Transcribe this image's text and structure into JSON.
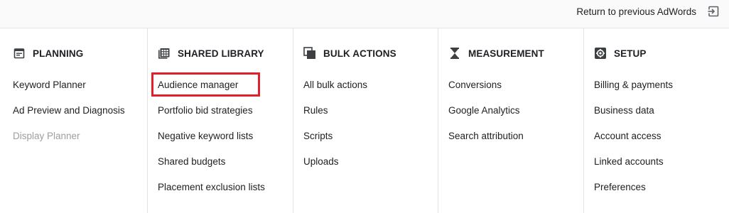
{
  "topbar": {
    "return_label": "Return to previous AdWords",
    "return_icon": "exit-to-app-icon"
  },
  "columns": [
    {
      "title": "PLANNING",
      "icon": "calendar-icon",
      "items": [
        {
          "label": "Keyword Planner",
          "disabled": false
        },
        {
          "label": "Ad Preview and Diagnosis",
          "disabled": false
        },
        {
          "label": "Display Planner",
          "disabled": true
        }
      ]
    },
    {
      "title": "SHARED LIBRARY",
      "icon": "library-grid-icon",
      "items": [
        {
          "label": "Audience manager",
          "highlighted": true
        },
        {
          "label": "Portfolio bid strategies"
        },
        {
          "label": "Negative keyword lists"
        },
        {
          "label": "Shared budgets"
        },
        {
          "label": "Placement exclusion lists"
        }
      ]
    },
    {
      "title": "BULK ACTIONS",
      "icon": "copy-stack-icon",
      "items": [
        {
          "label": "All bulk actions"
        },
        {
          "label": "Rules"
        },
        {
          "label": "Scripts"
        },
        {
          "label": "Uploads"
        }
      ]
    },
    {
      "title": "MEASUREMENT",
      "icon": "hourglass-icon",
      "items": [
        {
          "label": "Conversions"
        },
        {
          "label": "Google Analytics"
        },
        {
          "label": "Search attribution"
        }
      ]
    },
    {
      "title": "SETUP",
      "icon": "settings-gear-icon",
      "items": [
        {
          "label": "Billing & payments"
        },
        {
          "label": "Business data"
        },
        {
          "label": "Account access"
        },
        {
          "label": "Linked accounts"
        },
        {
          "label": "Preferences"
        }
      ]
    }
  ],
  "colors": {
    "highlight": "#e0202b",
    "disabled_text": "#9e9e9e",
    "divider": "#e4e4e4"
  }
}
